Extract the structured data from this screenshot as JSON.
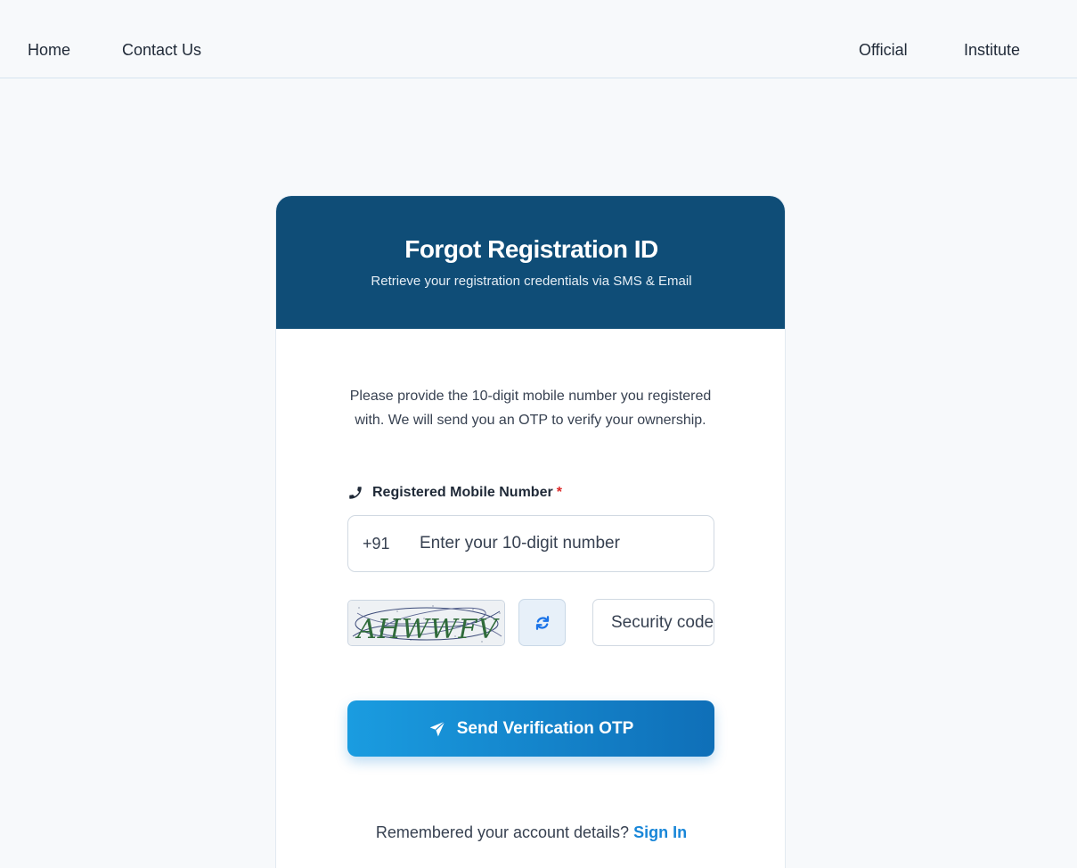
{
  "nav": {
    "home": "Home",
    "contact": "Contact Us",
    "official": "Official",
    "institute": "Institute"
  },
  "card": {
    "title": "Forgot Registration ID",
    "subtitle": "Retrieve your registration credentials via SMS & Email",
    "intro": "Please provide the 10-digit mobile number you registered with. We will send you an OTP to verify your ownership.",
    "mobile_label": "Registered Mobile Number",
    "required_mark": "*",
    "country_code": "+91",
    "mobile_placeholder": "Enter your 10-digit number",
    "captcha_text": "AHWWFV",
    "security_placeholder": "Security code",
    "send_button": "Send Verification OTP",
    "remembered_text": "Remembered your account details?",
    "signin_link": "Sign In"
  },
  "icons": {
    "phone": "phone-icon",
    "refresh": "refresh-icon",
    "send": "paper-plane-icon"
  },
  "colors": {
    "header_bg": "#0f4d77",
    "button_start": "#1a9ce0",
    "button_end": "#0f6fb8",
    "link": "#1886d8",
    "required": "#dc2626"
  }
}
